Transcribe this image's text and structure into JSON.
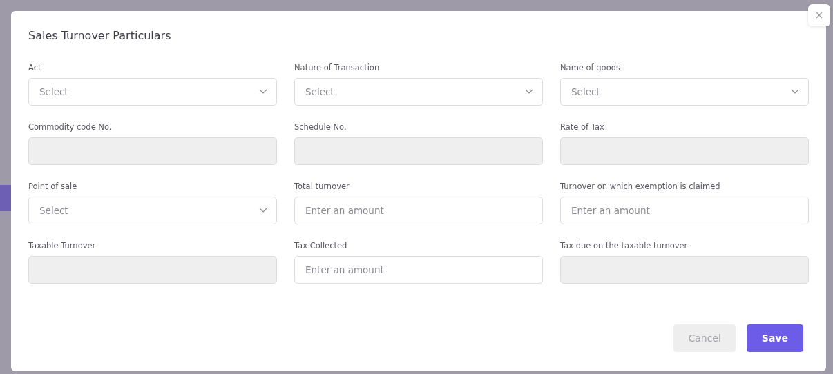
{
  "dialog": {
    "title": "Sales Turnover Particulars",
    "fields": [
      {
        "label": "Act",
        "kind": "select",
        "placeholder": "Select"
      },
      {
        "label": "Nature of Transaction",
        "kind": "select",
        "placeholder": "Select"
      },
      {
        "label": "Name of goods",
        "kind": "select",
        "placeholder": "Select"
      },
      {
        "label": "Commodity code No.",
        "kind": "readonly"
      },
      {
        "label": "Schedule No.",
        "kind": "readonly"
      },
      {
        "label": "Rate of Tax",
        "kind": "readonly"
      },
      {
        "label": "Point of sale",
        "kind": "select",
        "placeholder": "Select"
      },
      {
        "label": "Total turnover",
        "kind": "amount",
        "placeholder": "Enter an amount"
      },
      {
        "label": "Turnover on which exemption is claimed",
        "kind": "amount",
        "placeholder": "Enter an amount"
      },
      {
        "label": "Taxable Turnover",
        "kind": "readonly"
      },
      {
        "label": "Tax Collected",
        "kind": "amount",
        "placeholder": "Enter an amount"
      },
      {
        "label": "Tax due on the taxable turnover",
        "kind": "readonly"
      }
    ],
    "buttons": [
      {
        "label": "Cancel",
        "kind": "secondary"
      },
      {
        "label": "Save",
        "kind": "primary"
      }
    ]
  }
}
